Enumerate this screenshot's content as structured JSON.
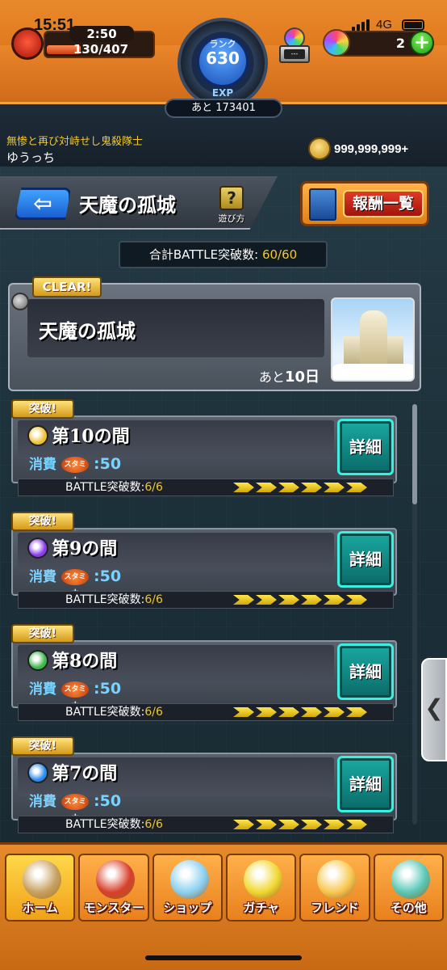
{
  "status_bar": {
    "time": "15:51",
    "network": "4G"
  },
  "header": {
    "stamina_timer": "2:50",
    "stamina": "130/407",
    "stamina_fraction": 0.32,
    "rank_label": "ランク",
    "rank": "630",
    "exp_label": "EXP",
    "exp_remaining": "あと 173401",
    "box_label": "---",
    "orb_count": "2",
    "plus_label": "+",
    "player_title": "無惨と再び対峙せし鬼殺隊士",
    "player_name": "ゆうっち",
    "coins": "999,999,999+"
  },
  "nav": {
    "back_label": "⇦",
    "title": "天魔の孤城",
    "help_icon": "?",
    "help_label": "遊び方",
    "reward_label": "報酬一覧"
  },
  "total_battle": {
    "label": "合計BATTLE突破数:",
    "value": "60/60"
  },
  "stage": {
    "clear_badge": "CLEAR!",
    "title": "天魔の孤城",
    "days_prefix": "あと",
    "days_value": "10日"
  },
  "rooms": [
    {
      "badge": "突破!",
      "name": "第10の間",
      "element": "light",
      "element_color": "#f0c030",
      "cost_label": "消費",
      "stamina_label": "スタミナ",
      "cost_value": ":50",
      "detail_label": "詳細",
      "battle_label": "BATTLE突破数:",
      "battle_value": "6/6",
      "progress": 6
    },
    {
      "badge": "突破!",
      "name": "第9の間",
      "element": "dark",
      "element_color": "#8a3af0",
      "cost_label": "消費",
      "stamina_label": "スタミナ",
      "cost_value": ":50",
      "detail_label": "詳細",
      "battle_label": "BATTLE突破数:",
      "battle_value": "6/6",
      "progress": 6
    },
    {
      "badge": "突破!",
      "name": "第8の間",
      "element": "wood",
      "element_color": "#3ab84a",
      "cost_label": "消費",
      "stamina_label": "スタミナ",
      "cost_value": ":50",
      "detail_label": "詳細",
      "battle_label": "BATTLE突破数:",
      "battle_value": "6/6",
      "progress": 6
    },
    {
      "badge": "突破!",
      "name": "第7の間",
      "element": "water",
      "element_color": "#2a8af0",
      "cost_label": "消費",
      "stamina_label": "スタミナ",
      "cost_value": ":50",
      "detail_label": "詳細",
      "battle_label": "BATTLE突破数:",
      "battle_value": "6/6",
      "progress": 6
    }
  ],
  "side_tab": {
    "icon": "chevron-left-icon",
    "glyph": "❮"
  },
  "bottom_tabs": [
    {
      "label": "ホーム",
      "icon": "home-icon",
      "color": "#c8a060",
      "active": true
    },
    {
      "label": "モンスター",
      "icon": "monster-icon",
      "color": "#d8402a",
      "active": false
    },
    {
      "label": "ショップ",
      "icon": "shop-orb-icon",
      "color": "#8ad0f0",
      "active": false
    },
    {
      "label": "ガチャ",
      "icon": "gacha-egg-icon",
      "color": "#f0d830",
      "active": false
    },
    {
      "label": "フレンド",
      "icon": "friend-icon",
      "color": "#f8c850",
      "active": false
    },
    {
      "label": "その他",
      "icon": "other-icon",
      "color": "#58c8b8",
      "active": false
    }
  ]
}
